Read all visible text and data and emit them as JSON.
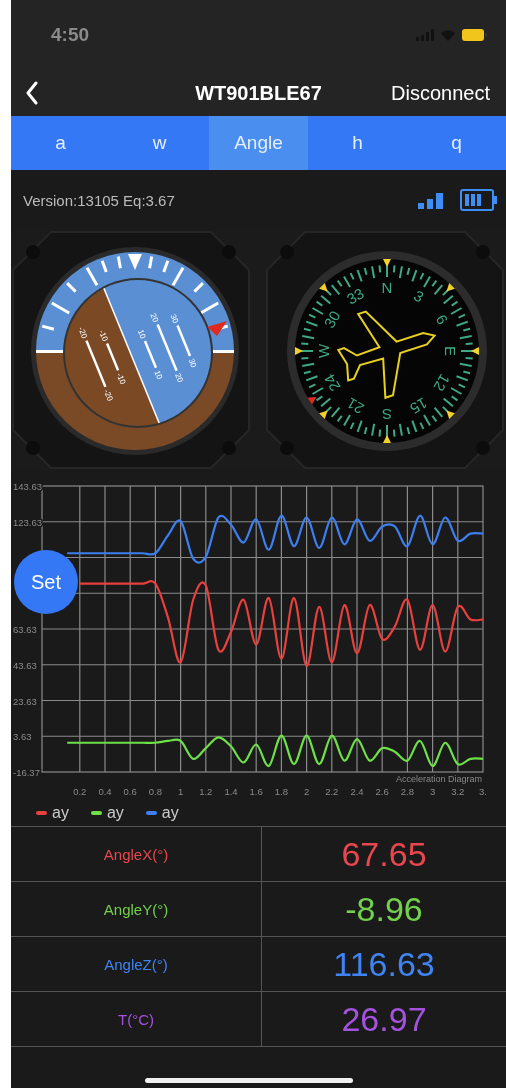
{
  "status_bar": {
    "time": "4:50"
  },
  "nav_bar": {
    "title": "WT901BLE67",
    "action": "Disconnect"
  },
  "tabs": [
    {
      "label": "a",
      "selected": false
    },
    {
      "label": "w",
      "selected": false
    },
    {
      "label": "Angle",
      "selected": true
    },
    {
      "label": "h",
      "selected": false
    },
    {
      "label": "q",
      "selected": false
    }
  ],
  "device_info": {
    "text": "Version:13105 Eq:3.67"
  },
  "attitude_indicator": {
    "pitch_lines": [
      {
        "left_label": "30",
        "right_label": "30"
      },
      {
        "left_label": "20",
        "right_label": "20"
      },
      {
        "left_label": "10",
        "right_label": "10"
      },
      {
        "left_label": "-10",
        "right_label": "-10"
      },
      {
        "left_label": "-20",
        "right_label": "-20"
      }
    ]
  },
  "compass": {
    "labels": [
      "N",
      "3",
      "6",
      "E",
      "12",
      "15",
      "S",
      "21",
      "24",
      "W",
      "30",
      "33"
    ]
  },
  "chart": {
    "set_button": "Set",
    "chart_data": {
      "type": "line",
      "x": [
        0.1,
        0.2,
        0.3,
        0.4,
        0.5,
        0.6,
        0.7,
        0.8,
        0.9,
        1.0,
        1.1,
        1.2,
        1.3,
        1.4,
        1.5,
        1.6,
        1.7,
        1.8,
        1.9,
        2.0,
        2.1,
        2.2,
        2.3,
        2.4,
        2.5,
        2.6,
        2.7,
        2.8,
        2.9,
        3.0,
        3.1,
        3.2,
        3.3,
        3.4
      ],
      "series": [
        {
          "name": "ay",
          "color": "#e8403c",
          "values": [
            null,
            89,
            89,
            89,
            89,
            89,
            89,
            89,
            70,
            45,
            80,
            88,
            52,
            62,
            80,
            55,
            81,
            47,
            81,
            43,
            76,
            45,
            77,
            50,
            77,
            58,
            65,
            80,
            52,
            77,
            51,
            76,
            69,
            69
          ]
        },
        {
          "name": "ay",
          "color": "#6ee048",
          "values": [
            0,
            0,
            0,
            0,
            0,
            0,
            0,
            0,
            1,
            1,
            -9,
            -3,
            3,
            -2,
            -11,
            -1,
            -13,
            4,
            -12,
            4,
            -12,
            4,
            -10,
            2,
            -10,
            -3,
            -5,
            -10,
            1,
            -13,
            0,
            -12,
            -9,
            -9
          ]
        },
        {
          "name": "ay",
          "color": "#3d7ff0",
          "values": [
            106,
            106,
            106,
            106,
            106,
            106,
            106,
            106,
            116,
            124,
            103,
            104,
            126,
            122,
            112,
            125,
            108,
            127,
            110,
            126,
            109,
            126,
            111,
            125,
            113,
            121,
            121,
            110,
            127,
            111,
            126,
            113,
            117,
            117
          ]
        }
      ],
      "xlim": [
        -0.1,
        3.4
      ],
      "ylim": [
        -16.37,
        143.63
      ],
      "xticks": [
        0.2,
        0.4,
        0.6,
        0.8,
        1.0,
        1.2,
        1.4,
        1.6,
        1.8,
        2.0,
        2.2,
        2.4,
        2.6,
        2.8,
        3.0,
        3.2,
        {
          "value": 3.4,
          "label": "3."
        }
      ],
      "yticks": [
        143.63,
        123.63,
        63.63,
        43.63,
        23.63,
        3.63,
        -16.37
      ],
      "grid": true,
      "annotations": [
        {
          "text": "Acceleration Diagram"
        }
      ]
    }
  },
  "readings": [
    {
      "label": "AngleX(°)",
      "value": "67.65",
      "color": "#e8474f"
    },
    {
      "label": "AngleY(°)",
      "value": "-8.96",
      "color": "#72d04c"
    },
    {
      "label": "AngleZ(°)",
      "value": "116.63",
      "color": "#3f84f2"
    },
    {
      "label": "T(°C)",
      "value": "26.97",
      "color": "#a452de"
    }
  ]
}
